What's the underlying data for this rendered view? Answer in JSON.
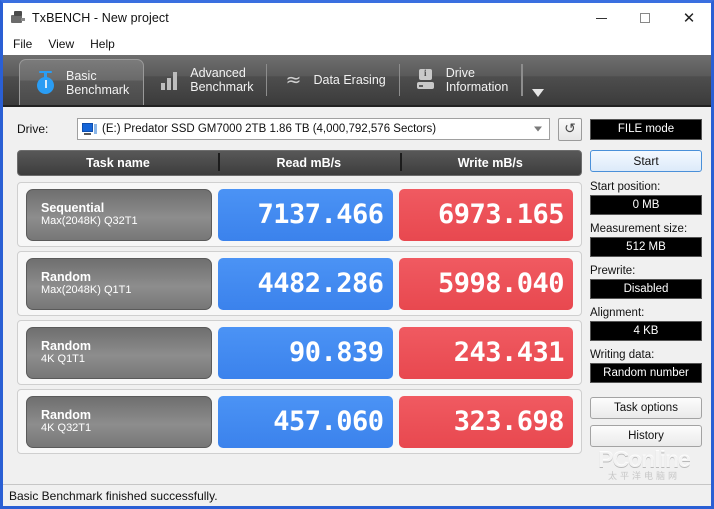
{
  "window": {
    "title": "TxBENCH - New project",
    "app_icon": "usb-drive-icon",
    "minimize": "minimize-icon",
    "maximize": "maximize-icon",
    "close": "close-icon"
  },
  "menu": {
    "items": [
      {
        "label": "File"
      },
      {
        "label": "View"
      },
      {
        "label": "Help"
      }
    ]
  },
  "tabs": {
    "overflow_icon": "chevron-down-icon",
    "items": [
      {
        "label": "Basic\nBenchmark",
        "icon": "stopwatch-icon",
        "active": true
      },
      {
        "label": "Advanced\nBenchmark",
        "icon": "bar-chart-icon",
        "active": false
      },
      {
        "label": "Data Erasing",
        "icon": "zigzag-wave-icon",
        "active": false
      },
      {
        "label": "Drive\nInformation",
        "icon": "drive-info-icon",
        "active": false
      }
    ]
  },
  "drive_row": {
    "label": "Drive:",
    "selected": "(E:) Predator SSD GM7000 2TB  1.86 TB (4,000,792,576 Sectors)",
    "drive_icon": "computer-drive-icon",
    "refresh_icon": "refresh-icon",
    "refresh_glyph": "↺",
    "file_mode_label": "FILE mode"
  },
  "results": {
    "headers": {
      "task": "Task name",
      "read": "Read mB/s",
      "write": "Write mB/s"
    },
    "rows": [
      {
        "task_line1": "Sequential",
        "task_line2": "Max(2048K) Q32T1",
        "read": "7137.466",
        "write": "6973.165"
      },
      {
        "task_line1": "Random",
        "task_line2": "Max(2048K) Q1T1",
        "read": "4482.286",
        "write": "5998.040"
      },
      {
        "task_line1": "Random",
        "task_line2": "4K Q1T1",
        "read": "90.839",
        "write": "243.431"
      },
      {
        "task_line1": "Random",
        "task_line2": "4K Q32T1",
        "read": "457.060",
        "write": "323.698"
      }
    ]
  },
  "sidebar": {
    "start_label": "Start",
    "fields": [
      {
        "label": "Start position:",
        "value": "0 MB"
      },
      {
        "label": "Measurement size:",
        "value": "512 MB"
      },
      {
        "label": "Prewrite:",
        "value": "Disabled"
      },
      {
        "label": "Alignment:",
        "value": "4 KB"
      },
      {
        "label": "Writing data:",
        "value": "Random number"
      }
    ],
    "task_options_label": "Task options",
    "history_label": "History"
  },
  "watermark": {
    "main": "PConline",
    "sub": "太平洋电脑网"
  },
  "statusbar": {
    "text": "Basic Benchmark finished successfully."
  },
  "colors": {
    "read_bar": "#3b82ec",
    "write_bar": "#e8484f",
    "window_border": "#2a5fd4",
    "tab_strip": "#5a5a5a",
    "accent_button": "#4a90d9"
  }
}
